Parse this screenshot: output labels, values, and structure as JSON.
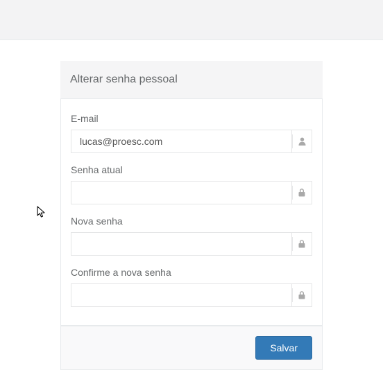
{
  "card": {
    "title": "Alterar senha pessoal"
  },
  "fields": {
    "email": {
      "label": "E-mail",
      "value": "lucas@proesc.com"
    },
    "current": {
      "label": "Senha atual",
      "value": ""
    },
    "new": {
      "label": "Nova senha",
      "value": ""
    },
    "confirm": {
      "label": "Confirme a nova senha",
      "value": ""
    }
  },
  "actions": {
    "save": "Salvar"
  }
}
